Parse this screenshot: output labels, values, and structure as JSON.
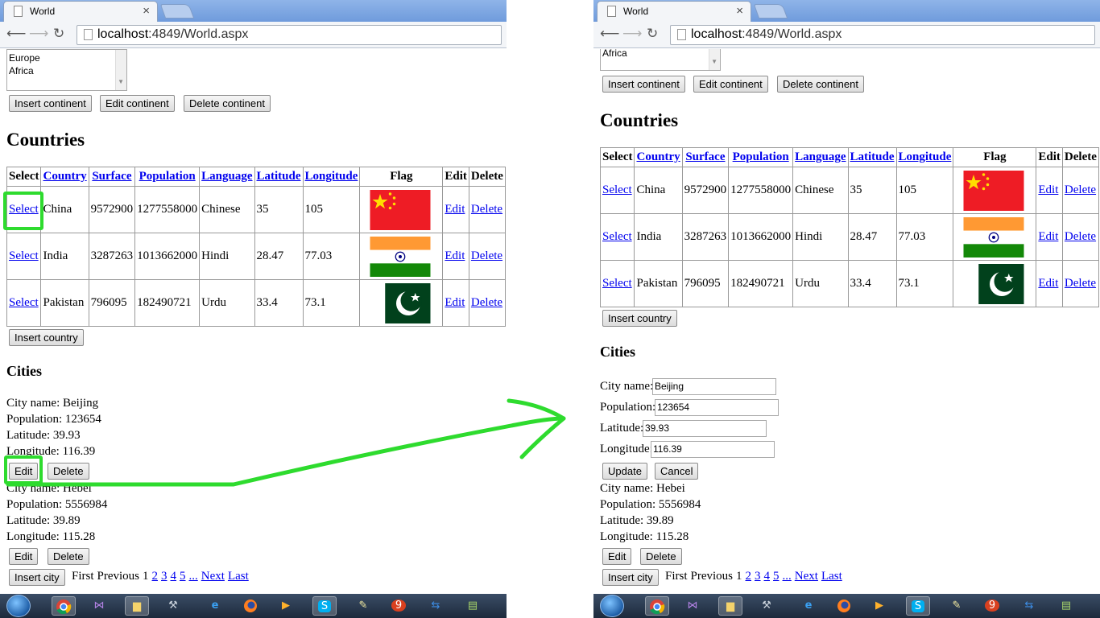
{
  "browser": {
    "tab_title": "World",
    "close_glyph": "×",
    "url_host": "localhost",
    "url_rest": ":4849/World.aspx"
  },
  "continents": {
    "list_items_left": [
      "Europe",
      "Africa"
    ],
    "list_items_right": [
      "Africa"
    ],
    "insert_label": "Insert continent",
    "edit_label": "Edit continent",
    "delete_label": "Delete continent"
  },
  "countries": {
    "heading": "Countries",
    "columns": [
      "Select",
      "Country",
      "Surface",
      "Population",
      "Language",
      "Latitude",
      "Longitude",
      "Flag",
      "Edit",
      "Delete"
    ],
    "rows": [
      {
        "select": "Select",
        "country": "China",
        "surface": "9572900",
        "population": "1277558000",
        "language": "Chinese",
        "latitude": "35",
        "longitude": "105",
        "flag": "china-flag",
        "edit": "Edit",
        "delete": "Delete"
      },
      {
        "select": "Select",
        "country": "India",
        "surface": "3287263",
        "population": "1013662000",
        "language": "Hindi",
        "latitude": "28.47",
        "longitude": "77.03",
        "flag": "india-flag",
        "edit": "Edit",
        "delete": "Delete"
      },
      {
        "select": "Select",
        "country": "Pakistan",
        "surface": "796095",
        "population": "182490721",
        "language": "Urdu",
        "latitude": "33.4",
        "longitude": "73.1",
        "flag": "pakistan-flag",
        "edit": "Edit",
        "delete": "Delete"
      }
    ],
    "insert_label": "Insert country"
  },
  "cities": {
    "heading": "Cities",
    "labels": {
      "name": "City name:",
      "population": "Population:",
      "latitude": "Latitude:",
      "longitude": "Longitude:"
    },
    "items": [
      {
        "name": "Beijing",
        "population": "123654",
        "latitude": "39.93",
        "longitude": "116.39"
      },
      {
        "name": "Hebei",
        "population": "5556984",
        "latitude": "39.89",
        "longitude": "115.28"
      }
    ],
    "edit_label": "Edit",
    "delete_label": "Delete",
    "update_label": "Update",
    "cancel_label": "Cancel",
    "insert_label": "Insert city",
    "pager": {
      "first": "First",
      "previous": "Previous",
      "current": "1",
      "pages": [
        "2",
        "3",
        "4",
        "5"
      ],
      "ellipsis": "...",
      "next": "Next",
      "last": "Last"
    }
  },
  "taskbar_icons": [
    "start-orb",
    "chrome-icon",
    "visual-studio-icon",
    "file-explorer-icon",
    "tools-icon",
    "internet-explorer-icon",
    "firefox-icon",
    "media-player-icon",
    "skype-icon",
    "notepad-icon",
    "app-9-icon",
    "teamviewer-icon",
    "notes-icon"
  ],
  "colors": {
    "annotation_green": "#2edb2e",
    "link_blue": "#0000ee",
    "china_red": "#ee1c25",
    "india_saffron": "#ff9933",
    "india_green": "#138808",
    "pakistan_green": "#01411c"
  }
}
